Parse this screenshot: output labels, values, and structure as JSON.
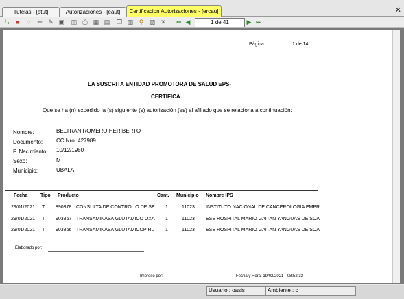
{
  "tabs": [
    {
      "label": "Tutelas - [etut]"
    },
    {
      "label": "Autorizaciones - [eaut]"
    },
    {
      "label": "Certificacion Autorizaciones - [ercau]"
    }
  ],
  "toolbar": {
    "page_indicator": "1 de 41"
  },
  "report": {
    "page_label": "Página",
    "page_sep": ":",
    "page_value": "1 de 14",
    "heading": "LA SUSCRITA ENTIDAD PROMOTORA DE SALUD EPS-",
    "subheading": "CERTIFICA",
    "intro": "Que se ha (n) expedido la (s) siguiente (s) autorización (es) al afiliado que se relaciona a continuación:",
    "fields": [
      {
        "label": "Nombre:",
        "value": "BELTRAN ROMERO HERIBERTO"
      },
      {
        "label": "Documento:",
        "value": "CC  Nro.  427989"
      },
      {
        "label": "F. Nacimiento:",
        "value": "10/12/1950"
      },
      {
        "label": "Sexo:",
        "value": "M"
      },
      {
        "label": "Municipio:",
        "value": "UBALA"
      }
    ],
    "columns": [
      "Fecha",
      "Tipo",
      "Producto",
      "Cant.",
      "Municipio",
      "Nombre IPS"
    ],
    "rows": [
      [
        "29/01/2021",
        "T",
        "890378",
        "CONSULTA DE CONTROL O DE SEGUI",
        "1",
        "11023",
        "INSTITUTO NACIONAL DE CANCEROLOGIA EMPRESA S"
      ],
      [
        "29/01/2021",
        "T",
        "903867",
        "TRANSAMINASA GLUTAMICO OXALAC",
        "1",
        "11023",
        "ESE HOSPITAL MARIO GAITAN YANGUAS DE SOACHA"
      ],
      [
        "29/01/2021",
        "T",
        "903866",
        "TRANSAMINASA GLUTAMICOPIRUVIC",
        "1",
        "11023",
        "ESE HOSPITAL MARIO GAITAN YANGUAS DE SOACHA"
      ]
    ],
    "elaborado_label": "Elaborado por:",
    "impreso_label": "Impreso por:",
    "fecha_hora": "Fecha y Hora:  19/02/2021  -  08:52:32"
  },
  "status": {
    "usuario": "Usuario : oasis",
    "ambiente": "Ambiente : c"
  },
  "colors": {
    "active_tab": "#ffff66",
    "nav_green": "#2e8b2e"
  }
}
